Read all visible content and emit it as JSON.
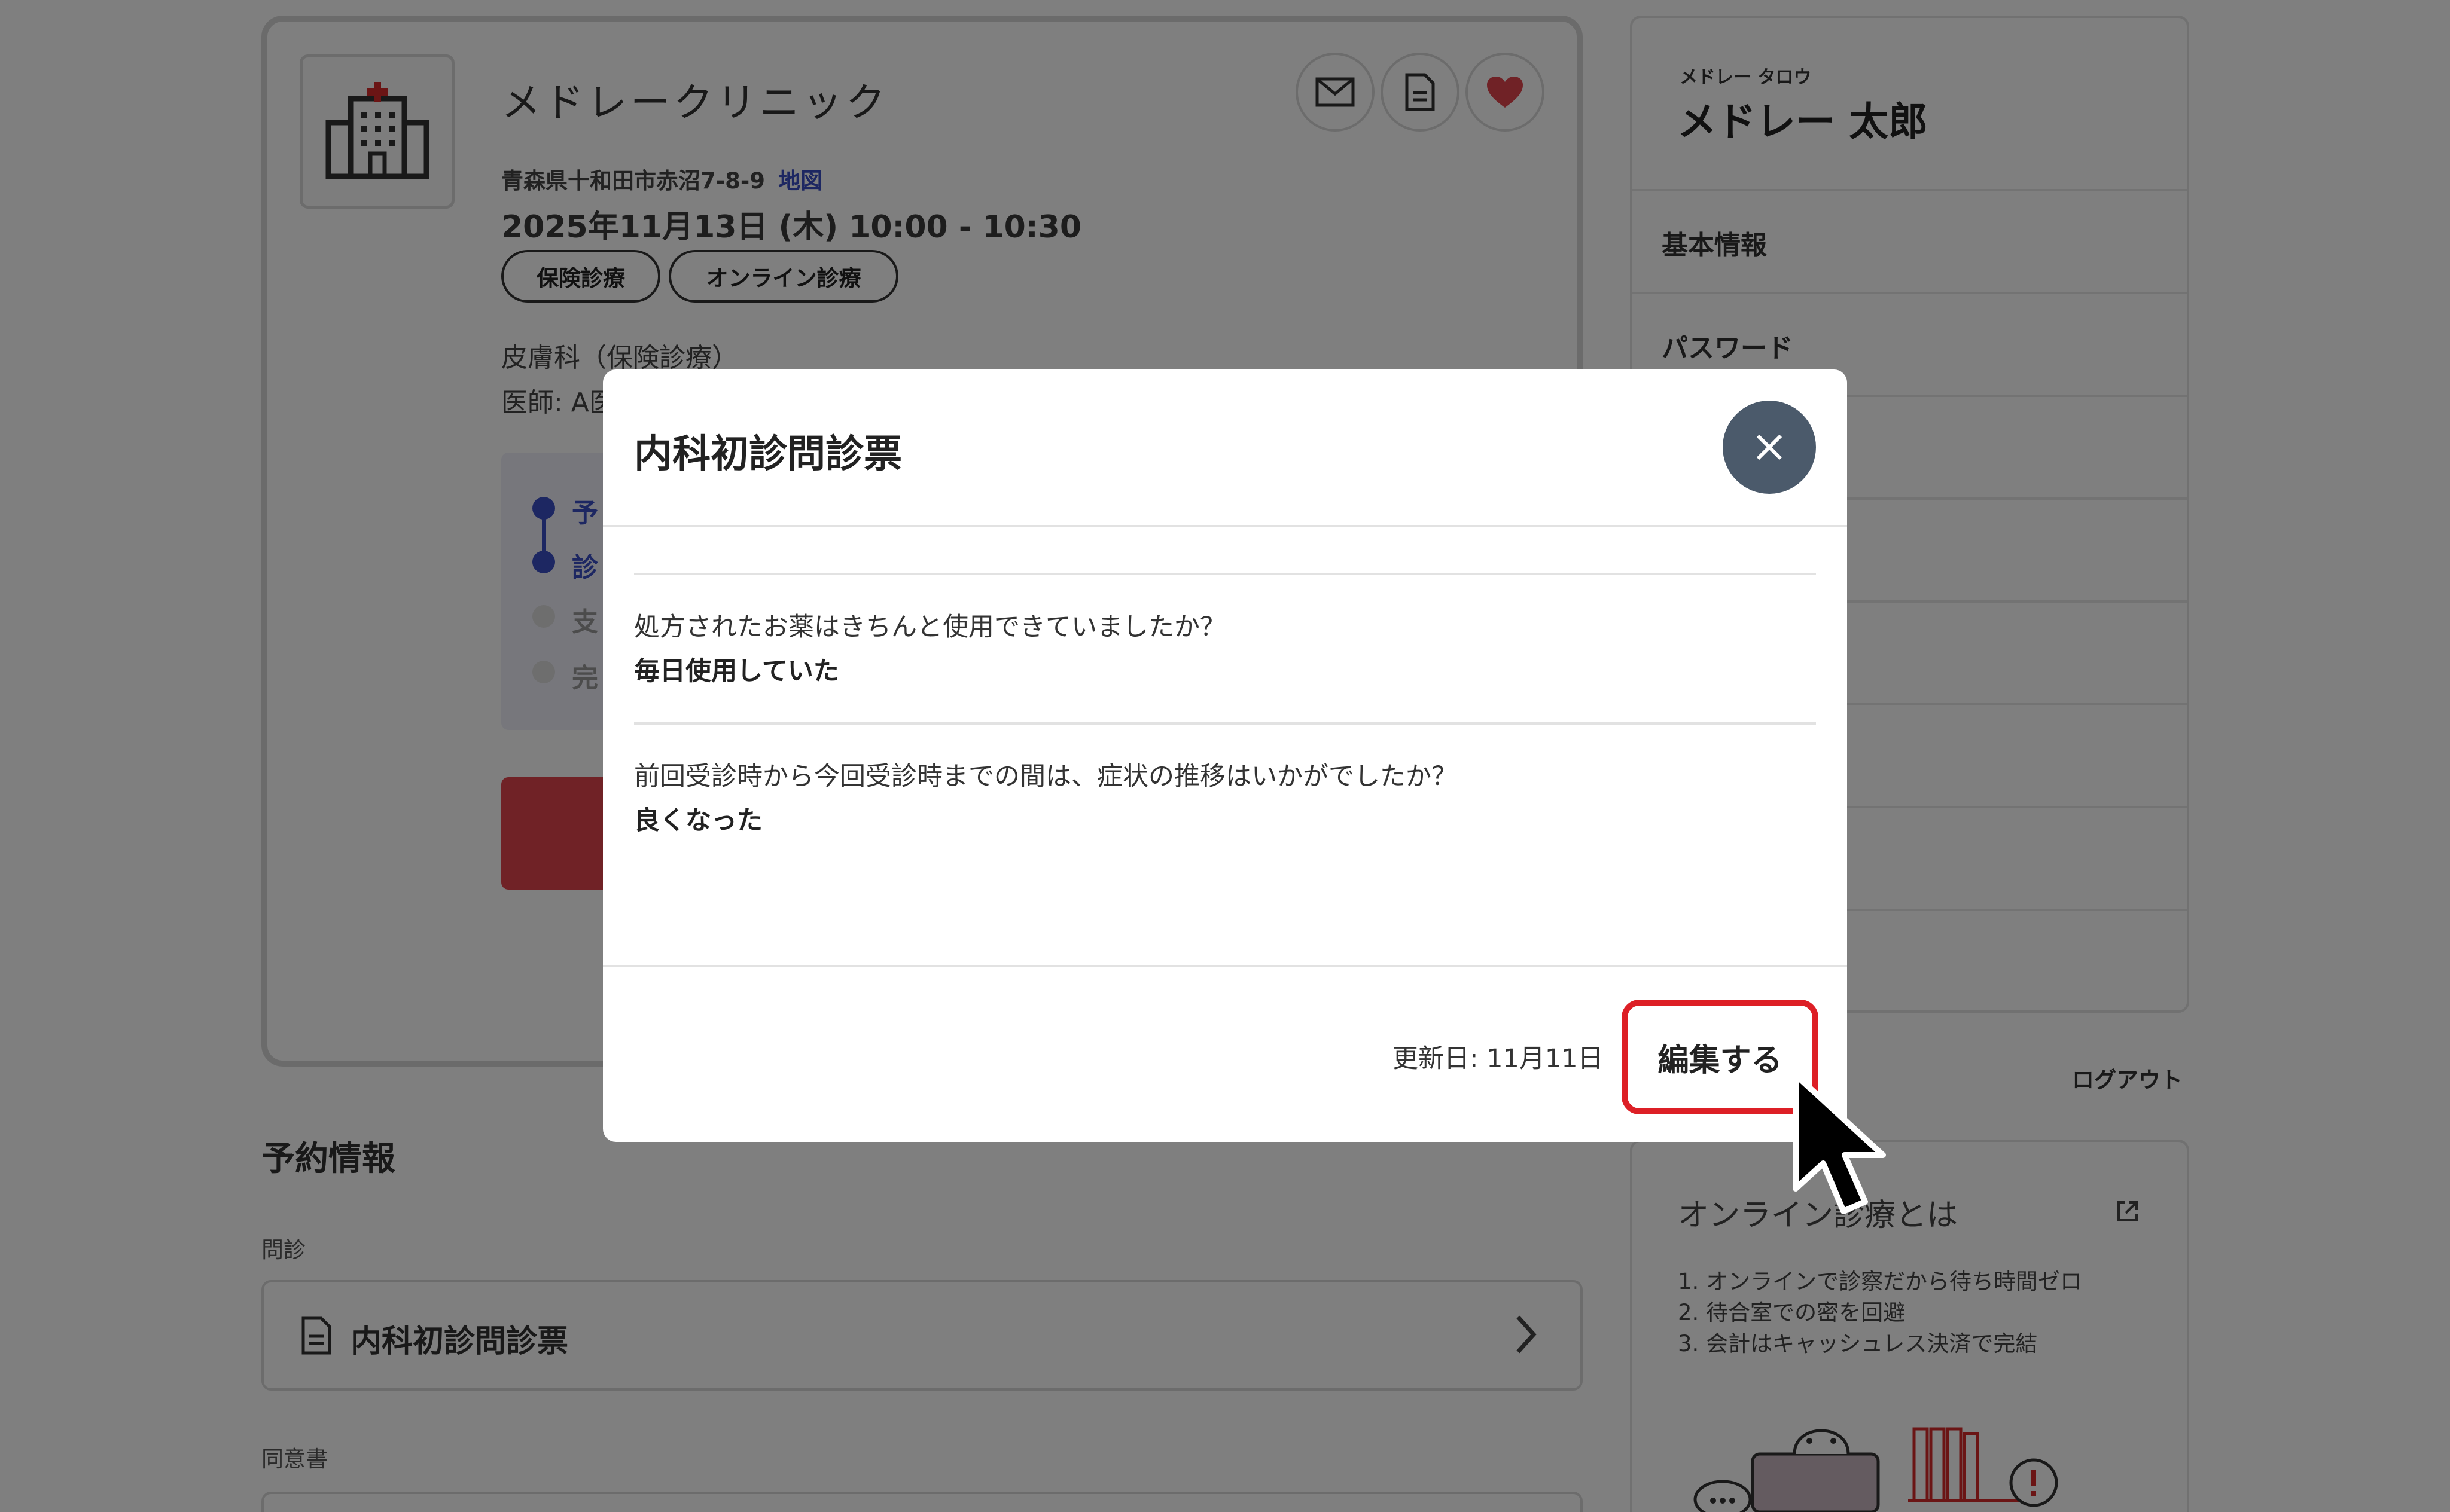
{
  "clinic": {
    "name": "メドレークリニック",
    "address": "青森県十和田市赤沼7-8-9",
    "map_link": "地図",
    "datetime": "2025年11月13日 (木) 10:00 - 10:30",
    "tags": [
      "保険診療",
      "オンライン診療"
    ],
    "specialty": "皮膚科（保険診療）",
    "doctor": "医師: A医",
    "steps": [
      "予",
      "診",
      "支",
      "完"
    ],
    "icons": [
      "mail-icon",
      "document-icon",
      "heart-icon"
    ]
  },
  "reservation": {
    "section_title": "予約情報",
    "interview_label": "問診",
    "interview_item": "内科初診問診票",
    "consent_label": "同意書"
  },
  "user": {
    "kana": "メドレー タロウ",
    "name": "メドレー 太郎"
  },
  "side_menu": {
    "items": [
      "基本情報",
      "パスワード"
    ],
    "logout": "ログアウト"
  },
  "info_card": {
    "title": "オンライン診療とは",
    "points": [
      "1. オンラインで診察だから待ち時間ゼロ",
      "2. 待合室での密を回避",
      "3. 会計はキャッシュレス決済で完結"
    ]
  },
  "modal": {
    "title": "内科初診問診票",
    "qa": [
      {
        "question": "処方されたお薬はきちんと使用できていましたか？",
        "answer": "毎日使用していた"
      },
      {
        "question": "前回受診時から今回受診時までの間は、症状の推移はいかがでしたか？",
        "answer": "良くなった"
      }
    ],
    "updated": "更新日: 11月11日",
    "edit_label": "編集する"
  },
  "colors": {
    "accent_blue": "#3a4fc4",
    "danger_red": "#dd1f26",
    "close_button": "#4b5a6b",
    "heart": "#e0454d"
  }
}
